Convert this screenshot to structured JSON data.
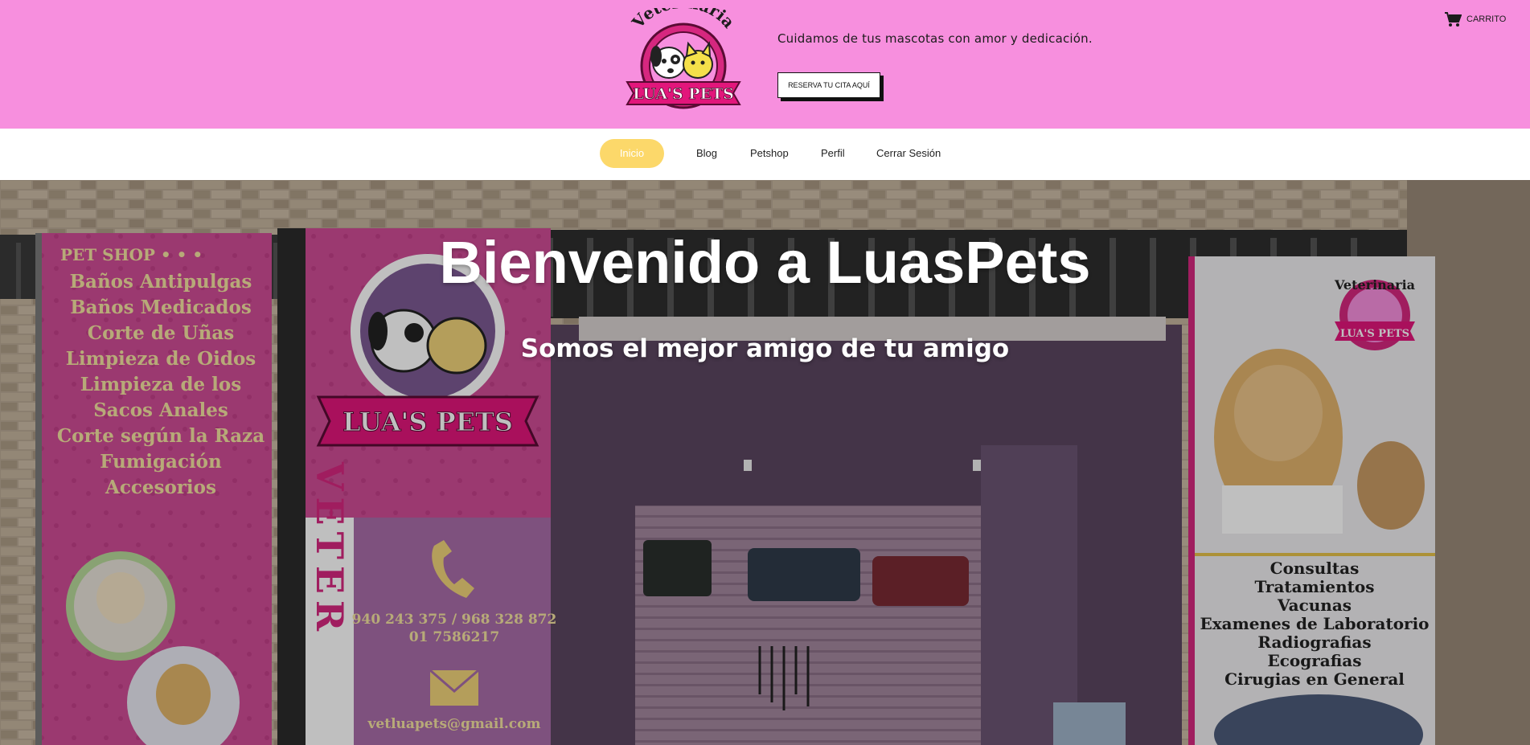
{
  "header": {
    "logo": {
      "top_text": "Veterinaria",
      "banner_text": "LUA'S PETS"
    },
    "tagline": "Cuidamos de tus mascotas con amor y dedicación.",
    "booking_button": "RESERVA TU CITA AQUÍ",
    "cart": {
      "icon": "cart-icon",
      "label": "CARRITO"
    }
  },
  "nav": {
    "items": [
      {
        "label": "Inicio",
        "active": true
      },
      {
        "label": "Blog",
        "active": false
      },
      {
        "label": "Petshop",
        "active": false
      },
      {
        "label": "Perfil",
        "active": false
      },
      {
        "label": "Cerrar Sesión",
        "active": false
      }
    ]
  },
  "hero": {
    "title": "Bienvenido a LuasPets",
    "subtitle": "Somos el mejor amigo de tu amigo",
    "photo": {
      "left_sign": {
        "heading": "PET SHOP • • •",
        "services": [
          "Baños Antipulgas",
          "Baños Medicados",
          "Corte de Uñas",
          "Limpieza de Oidos",
          "Limpieza de los",
          "Sacos Anales",
          "Corte según la Raza",
          "Fumigación",
          "Accesorios"
        ]
      },
      "center_sign": {
        "banner_text": "LUA'S PETS",
        "vertical_text": "VETER",
        "phones": "940 243 375 / 968 328 872",
        "phone2": "01 7586217",
        "email": "vetluapets@gmail.com"
      },
      "right_sign": {
        "logo_top": "Veterinaria",
        "logo_banner": "LUA'S PETS",
        "services": [
          "Consultas",
          "Tratamientos",
          "Vacunas",
          "Examenes de Laboratorio",
          "Radiografias",
          "Ecografias",
          "Cirugias en General"
        ]
      }
    }
  },
  "colors": {
    "header_bg": "#f78fde",
    "nav_active_bg": "#fcd86a",
    "sign_pink": "#d9559f",
    "sign_text": "#f4e3a0"
  }
}
